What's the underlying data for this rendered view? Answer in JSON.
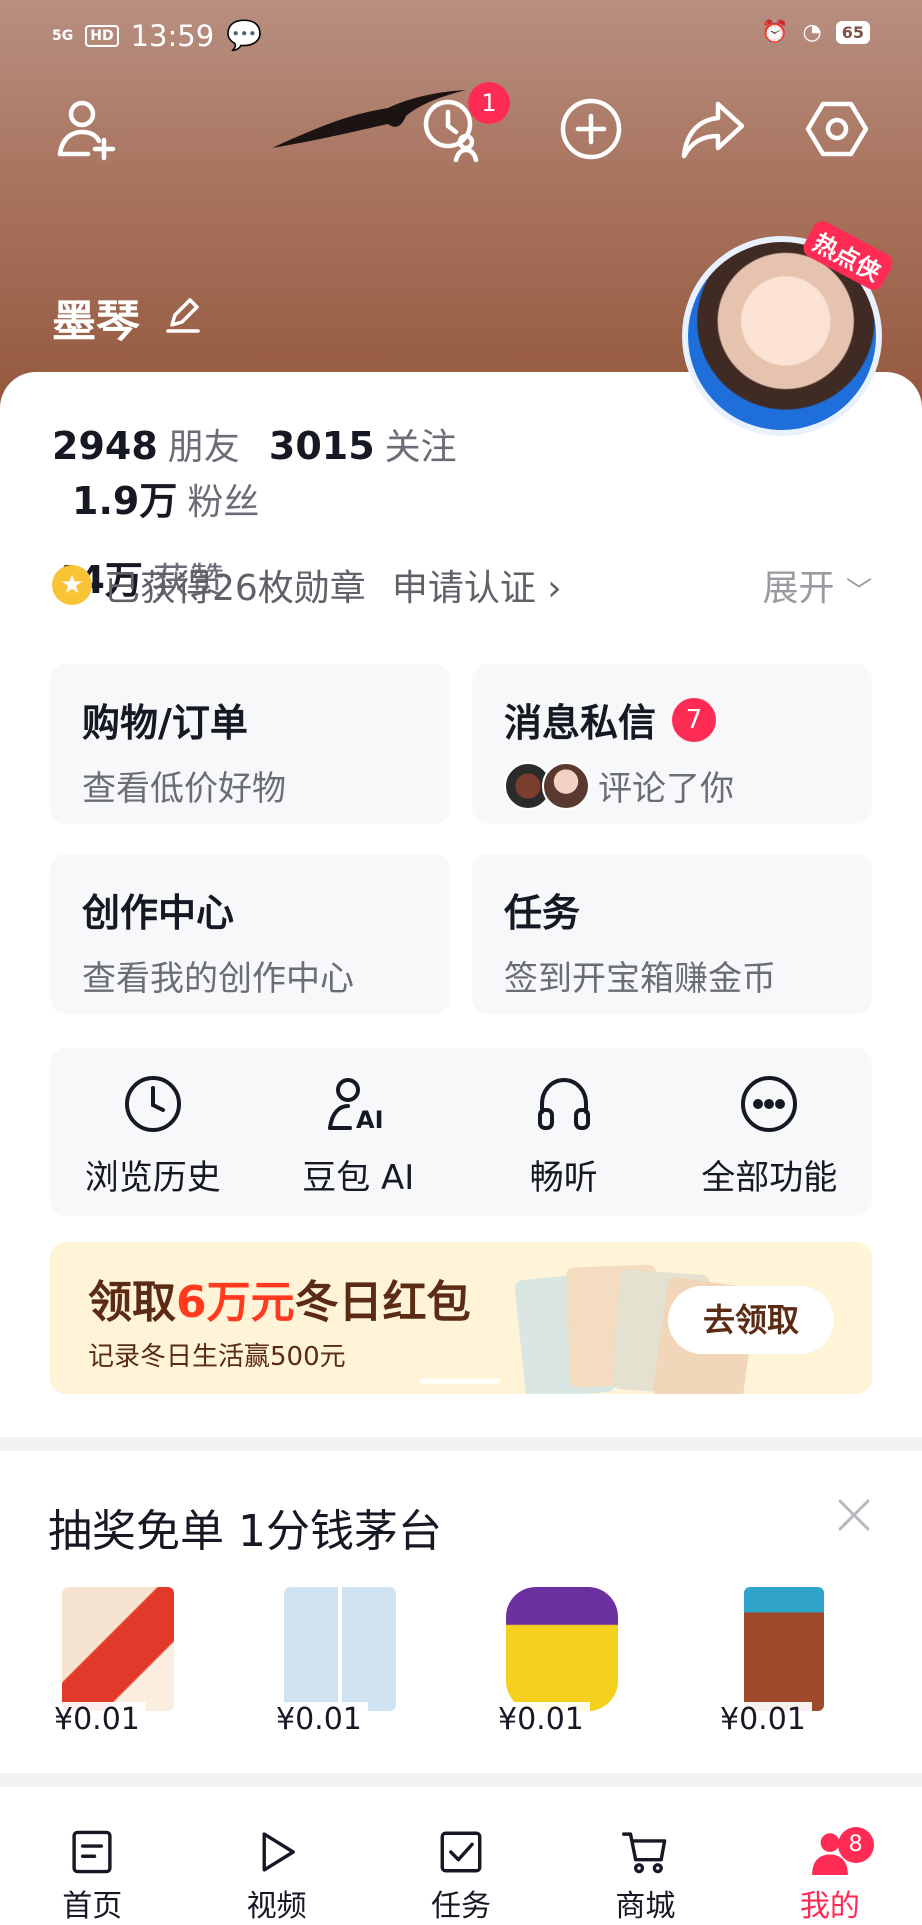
{
  "status_bar": {
    "signal": "5G",
    "hd": "HD",
    "time": "13:59",
    "battery": "65"
  },
  "header": {
    "friend_badge": "1"
  },
  "profile": {
    "username": "墨琴",
    "avatar_tag": "热点侠",
    "stats": {
      "friends": {
        "value": "2948",
        "label": "朋友"
      },
      "following": {
        "value": "3015",
        "label": "关注"
      },
      "followers": {
        "value": "1.9万",
        "label": "粉丝"
      },
      "likes": {
        "value": "44万",
        "label": "获赞"
      }
    },
    "medals": "已获得26枚勋章",
    "verify": "申请认证 ›",
    "expand": "展开"
  },
  "cards": [
    {
      "title": "购物/订单",
      "sub": "查看低价好物"
    },
    {
      "title": "消息私信",
      "badge": "7",
      "sub": "评论了你"
    },
    {
      "title": "创作中心",
      "sub": "查看我的创作中心"
    },
    {
      "title": "任务",
      "sub": "签到开宝箱赚金币"
    }
  ],
  "tools": [
    {
      "label": "浏览历史",
      "icon": "clock-icon"
    },
    {
      "label": "豆包 AI",
      "icon": "ai-assistant-icon"
    },
    {
      "label": "畅听",
      "icon": "headphones-icon"
    },
    {
      "label": "全部功能",
      "icon": "more-icon"
    }
  ],
  "banner": {
    "title_pre": "领取",
    "title_highlight": "6万元",
    "title_post": "冬日红包",
    "sub": "记录冬日生活赢500元",
    "button": "去领取"
  },
  "deal": {
    "title": "抽奖免单 1分钱茅台",
    "products": [
      {
        "price": "¥0.01"
      },
      {
        "price": "¥0.01"
      },
      {
        "price": "¥0.01"
      },
      {
        "price": "¥0.01"
      }
    ]
  },
  "tabbar": [
    {
      "label": "首页"
    },
    {
      "label": "视频"
    },
    {
      "label": "任务"
    },
    {
      "label": "商城"
    },
    {
      "label": "我的",
      "badge": "8"
    }
  ],
  "colors": {
    "accent": "#fe2c55",
    "header": "#a8735e",
    "banner": "#fff4d8"
  }
}
